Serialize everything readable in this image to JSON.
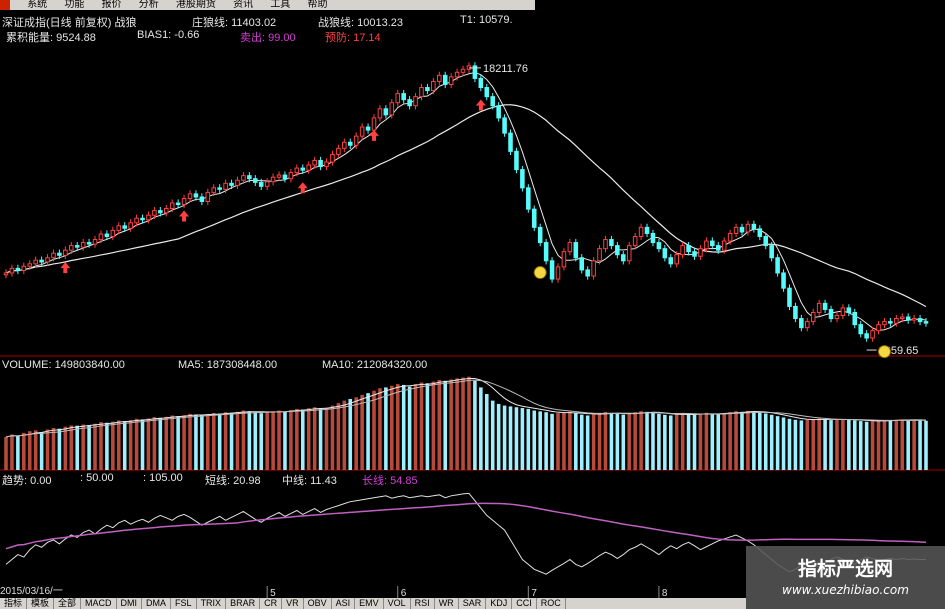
{
  "menu": [
    "系统",
    "功能",
    "报价",
    "分析",
    "港股期货",
    "资讯",
    "工具",
    "帮助"
  ],
  "header": {
    "line1": [
      {
        "text": "深证成指(日线 前复权) 战狼",
        "color": "w"
      },
      {
        "text": "庄狼线: 11403.02",
        "color": "w"
      },
      {
        "text": "战狼线: 10013.23",
        "color": "w"
      },
      {
        "text": "T1: 10579.",
        "color": "w"
      }
    ],
    "line2": [
      {
        "text": "累积能量: 9524.88",
        "color": "w"
      },
      {
        "text": "BIAS1: -0.66",
        "color": "w"
      },
      {
        "text": "卖出: 99.00",
        "color": "p"
      },
      {
        "text": "预防: 17.14",
        "color": "r"
      }
    ]
  },
  "volume_header": {
    "label": "VOLUME: 149803840.00",
    "ma5": "MA5: 187308448.00",
    "ma10": "MA10: 212084320.00"
  },
  "indicator_header": {
    "trend": "趋势: 0.00",
    "l50": ": 50.00",
    "l105": ": 105.00",
    "short": "短线: 20.98",
    "mid": "中线: 11.43",
    "long": "长线: 54.85"
  },
  "date_label": "2015/03/16/一",
  "bottom_tabs": [
    "指标",
    "模板",
    "全部",
    "MACD",
    "DMI",
    "DMA",
    "FSL",
    "TRIX",
    "BRAR",
    "CR",
    "VR",
    "OBV",
    "ASI",
    "EMV",
    "VOL",
    "RSI",
    "WR",
    "SAR",
    "KDJ",
    "CCI",
    "ROC"
  ],
  "month_labels": [
    "5",
    "6",
    "7",
    "8"
  ],
  "watermark": {
    "title": "指标严选网",
    "url": "www.xuezhibiao.com"
  },
  "colors": {
    "up": "#ff4040",
    "down": "#54fcfc",
    "volUp": "#b84a3c",
    "volDown": "#9ff0ff",
    "ma": "#e8e8e8",
    "longLine": "#c060c0",
    "separator": "#b00000"
  },
  "chart_data": {
    "type": "candlestick",
    "start_date": "2015/03/16",
    "high_label": "18211.76",
    "low_label": "9259.65",
    "close": [
      11400,
      11550,
      11480,
      11620,
      11700,
      11820,
      11760,
      11900,
      12050,
      11980,
      12150,
      12300,
      12250,
      12400,
      12350,
      12500,
      12680,
      12600,
      12800,
      12950,
      12870,
      13050,
      13200,
      13150,
      13300,
      13450,
      13380,
      13520,
      13700,
      13650,
      13850,
      14000,
      13900,
      13750,
      14050,
      14200,
      14150,
      14350,
      14280,
      14450,
      14600,
      14500,
      14380,
      14250,
      14400,
      14550,
      14620,
      14500,
      14700,
      14850,
      14780,
      14950,
      15100,
      14900,
      15050,
      15300,
      15500,
      15700,
      15600,
      15900,
      16200,
      16100,
      16500,
      16800,
      16600,
      17000,
      17300,
      17100,
      16900,
      17200,
      17500,
      17400,
      17700,
      17900,
      17600,
      17850,
      18000,
      18100,
      18211,
      17800,
      17500,
      17200,
      16900,
      16500,
      16000,
      15400,
      14800,
      14200,
      13500,
      12900,
      12400,
      11800,
      11200,
      11600,
      12100,
      12400,
      11900,
      11500,
      11300,
      11800,
      12200,
      12500,
      12300,
      12000,
      11800,
      12300,
      12600,
      12900,
      12700,
      12400,
      12200,
      11900,
      11700,
      12000,
      12300,
      12100,
      11950,
      12200,
      12450,
      12300,
      12150,
      12450,
      12700,
      12900,
      12750,
      13000,
      12850,
      12600,
      12300,
      11900,
      11400,
      10900,
      10300,
      9900,
      9600,
      9800,
      10100,
      10400,
      10200,
      9900,
      10000,
      10250,
      10100,
      9700,
      9400,
      9259,
      9500,
      9700,
      9800,
      9750,
      9900,
      9950,
      9850,
      9900,
      9800,
      9750
    ],
    "volume": [
      200,
      215,
      205,
      225,
      235,
      240,
      230,
      245,
      255,
      250,
      262,
      270,
      268,
      275,
      272,
      280,
      290,
      286,
      292,
      300,
      296,
      302,
      310,
      306,
      312,
      320,
      316,
      322,
      330,
      326,
      332,
      340,
      335,
      330,
      338,
      345,
      342,
      350,
      346,
      352,
      360,
      356,
      350,
      344,
      350,
      356,
      360,
      354,
      362,
      370,
      366,
      374,
      380,
      372,
      378,
      390,
      405,
      420,
      430,
      440,
      455,
      465,
      480,
      495,
      500,
      510,
      520,
      515,
      505,
      520,
      530,
      525,
      535,
      545,
      540,
      548,
      555,
      560,
      565,
      540,
      500,
      460,
      420,
      400,
      390,
      385,
      380,
      375,
      370,
      360,
      355,
      350,
      340,
      345,
      348,
      352,
      342,
      335,
      330,
      338,
      345,
      352,
      346,
      340,
      335,
      344,
      350,
      356,
      352,
      346,
      340,
      334,
      330,
      336,
      342,
      338,
      334,
      340,
      346,
      342,
      338,
      344,
      350,
      356,
      352,
      358,
      354,
      348,
      342,
      334,
      326,
      318,
      310,
      304,
      300,
      304,
      308,
      312,
      308,
      302,
      304,
      308,
      306,
      300,
      296,
      292,
      296,
      300,
      302,
      300,
      304,
      306,
      302,
      304,
      300,
      298
    ],
    "short": [
      160,
      150,
      140,
      145,
      130,
      120,
      125,
      115,
      110,
      118,
      108,
      100,
      105,
      95,
      90,
      98,
      88,
      80,
      85,
      75,
      70,
      78,
      72,
      68,
      74,
      66,
      60,
      65,
      70,
      62,
      58,
      64,
      72,
      80,
      74,
      68,
      62,
      70,
      64,
      58,
      52,
      60,
      68,
      74,
      66,
      60,
      54,
      62,
      56,
      50,
      58,
      52,
      46,
      54,
      48,
      44,
      40,
      36,
      32,
      30,
      28,
      26,
      24,
      22,
      20,
      25,
      22,
      20,
      24,
      22,
      20,
      22,
      20,
      18,
      24,
      20,
      18,
      16,
      15,
      30,
      45,
      60,
      70,
      80,
      90,
      110,
      130,
      150,
      160,
      170,
      175,
      180,
      172,
      165,
      158,
      150,
      160,
      165,
      158,
      150,
      142,
      135,
      140,
      148,
      140,
      130,
      125,
      118,
      125,
      132,
      140,
      130,
      122,
      128,
      120,
      115,
      122,
      130,
      124,
      118,
      112,
      108,
      104,
      100,
      106,
      112,
      120,
      130,
      140,
      150,
      160,
      168,
      175,
      170,
      162,
      155,
      160,
      165,
      158,
      150,
      145,
      150,
      155,
      160,
      150,
      145,
      148,
      152,
      150,
      148,
      150,
      148,
      150,
      149,
      150,
      150
    ],
    "ylim_price": [
      8800,
      18800
    ]
  }
}
